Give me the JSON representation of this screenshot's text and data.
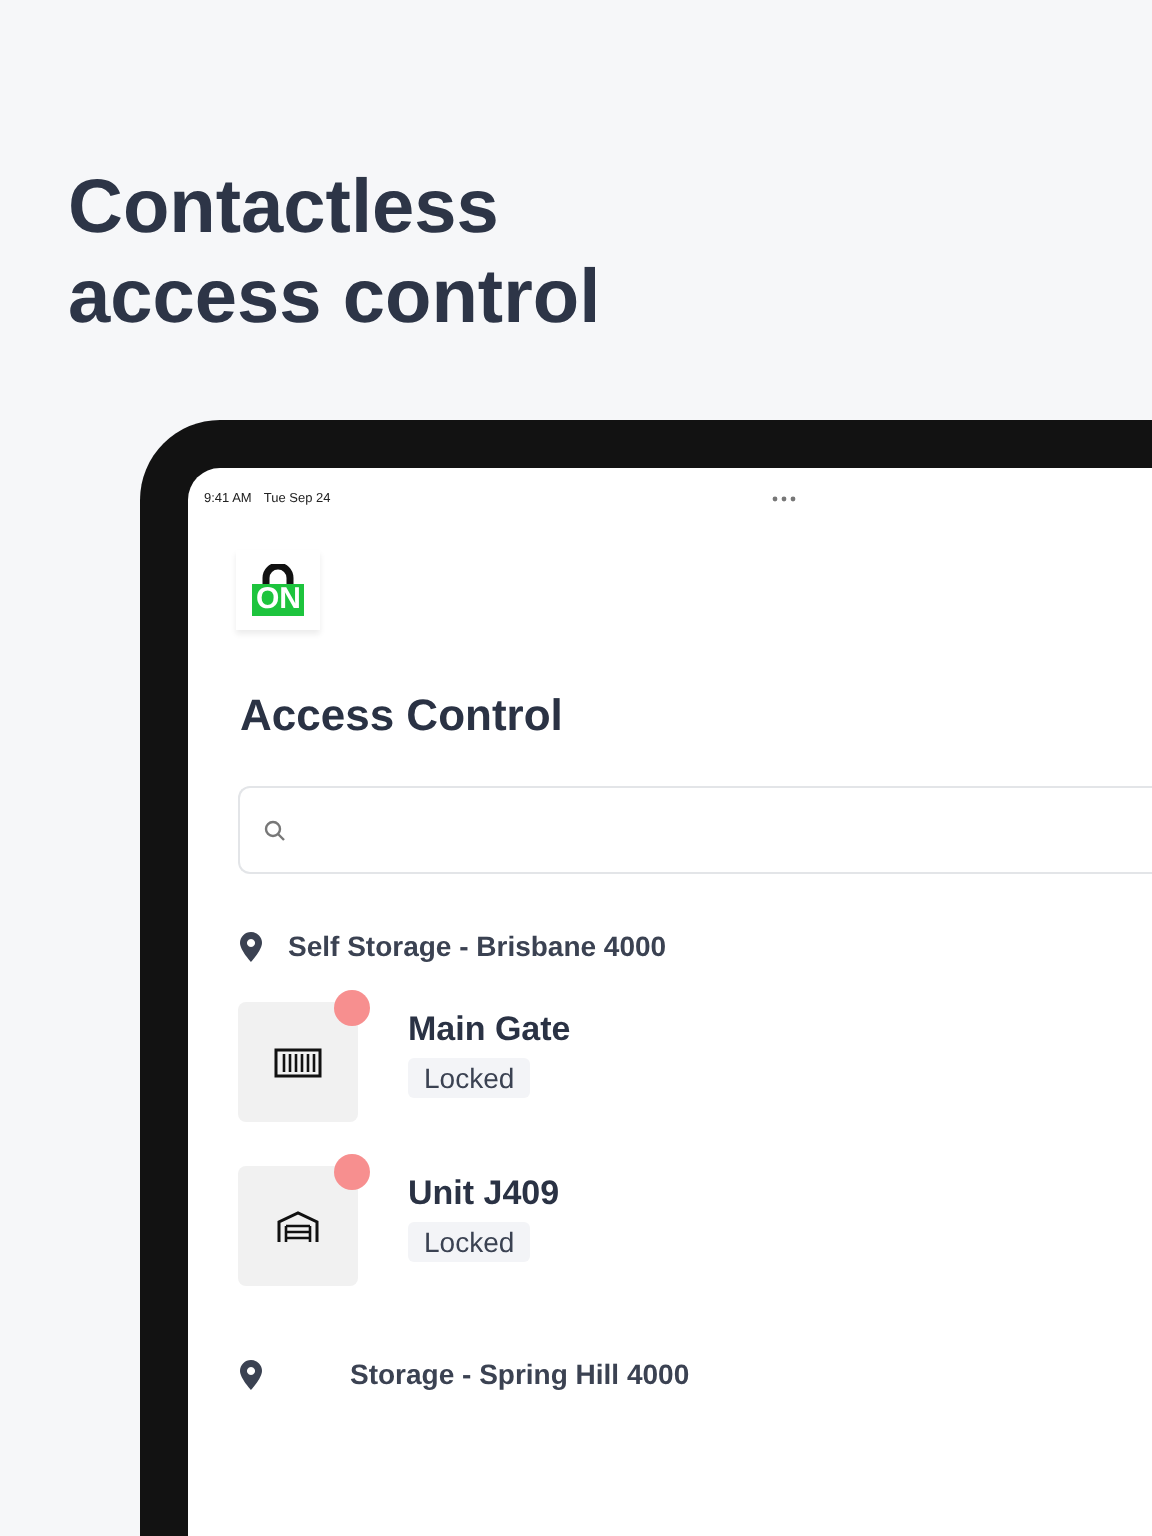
{
  "headline": "Contactless access control",
  "status_bar": {
    "time": "9:41 AM",
    "date": "Tue Sep 24"
  },
  "logo": {
    "text": "ON"
  },
  "title": "Access Control",
  "locations": [
    {
      "name": "Self Storage - Brisbane 4000",
      "units": [
        {
          "name": "Main Gate",
          "status": "Locked",
          "kind": "gate",
          "color": "#f78f8f"
        },
        {
          "name": "Unit J409",
          "status": "Locked",
          "kind": "garage",
          "color": "#f78f8f"
        }
      ]
    },
    {
      "name": "Storage - Spring Hill 4000"
    }
  ]
}
